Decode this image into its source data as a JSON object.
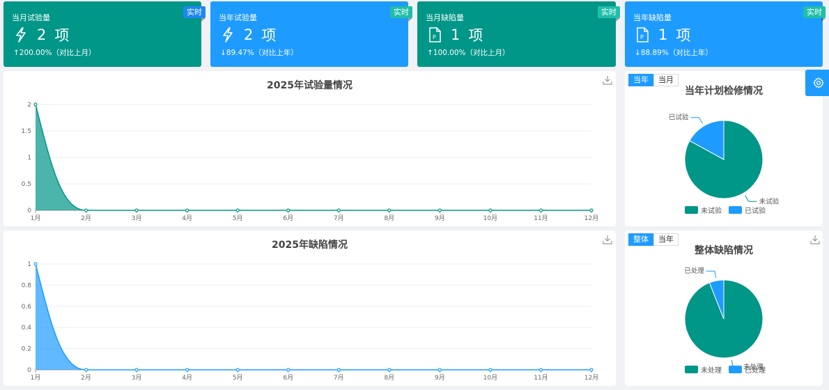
{
  "colors": {
    "teal": "#009688",
    "blue": "#1e9bff",
    "badge_teal": "#1fbfa9",
    "badge_blue": "#1e87f0"
  },
  "cards": [
    {
      "title": "当月试验量",
      "badge": "实时",
      "value": "2",
      "unit": "项",
      "delta": "↑200.00%（对比上月）",
      "icon": "lightning-icon"
    },
    {
      "title": "当年试验量",
      "badge": "实时",
      "value": "2",
      "unit": "项",
      "delta": "↓89.47%（对比上年）",
      "icon": "lightning-icon"
    },
    {
      "title": "当月缺陷量",
      "badge": "实时",
      "value": "1",
      "unit": "项",
      "delta": "↑100.00%（对比上月）",
      "icon": "document-p-icon"
    },
    {
      "title": "当年缺陷量",
      "badge": "实时",
      "value": "1",
      "unit": "项",
      "delta": "↓88.89%（对比上年）",
      "icon": "document-p-icon"
    }
  ],
  "pie_panels": [
    {
      "title": "当年计划检修情况",
      "toggles": [
        "当年",
        "当月"
      ],
      "active_toggle": 0
    },
    {
      "title": "整体缺陷情况",
      "toggles": [
        "整体",
        "当年"
      ],
      "active_toggle": 0
    }
  ],
  "chart_data": [
    {
      "type": "area",
      "title": "2025年试验量情况",
      "categories": [
        "1月",
        "2月",
        "3月",
        "4月",
        "5月",
        "6月",
        "7月",
        "8月",
        "9月",
        "10月",
        "11月",
        "12月"
      ],
      "values": [
        2,
        0,
        0,
        0,
        0,
        0,
        0,
        0,
        0,
        0,
        0,
        0
      ],
      "yticks": [
        "0",
        "0.5",
        "1",
        "1.5",
        "2"
      ],
      "ylim": [
        0,
        2
      ],
      "color": "#009688"
    },
    {
      "type": "area",
      "title": "2025年缺陷情况",
      "categories": [
        "1月",
        "2月",
        "3月",
        "4月",
        "5月",
        "6月",
        "7月",
        "8月",
        "9月",
        "10月",
        "11月",
        "12月"
      ],
      "values": [
        1,
        0,
        0,
        0,
        0,
        0,
        0,
        0,
        0,
        0,
        0,
        0
      ],
      "yticks": [
        "0",
        "0.2",
        "0.4",
        "0.6",
        "0.8",
        "1"
      ],
      "ylim": [
        0,
        1
      ],
      "color": "#1e9bff"
    },
    {
      "type": "pie",
      "slices": [
        {
          "label": "未试验",
          "value": 0.83,
          "color": "#009688"
        },
        {
          "label": "已试验",
          "value": 0.17,
          "color": "#1e9bff"
        }
      ],
      "legend": [
        "未试验",
        "已试验"
      ]
    },
    {
      "type": "pie",
      "slices": [
        {
          "label": "未处理",
          "value": 0.94,
          "color": "#009688"
        },
        {
          "label": "已处理",
          "value": 0.06,
          "color": "#1e9bff"
        }
      ],
      "legend": [
        "未处理",
        "已处理"
      ]
    }
  ]
}
